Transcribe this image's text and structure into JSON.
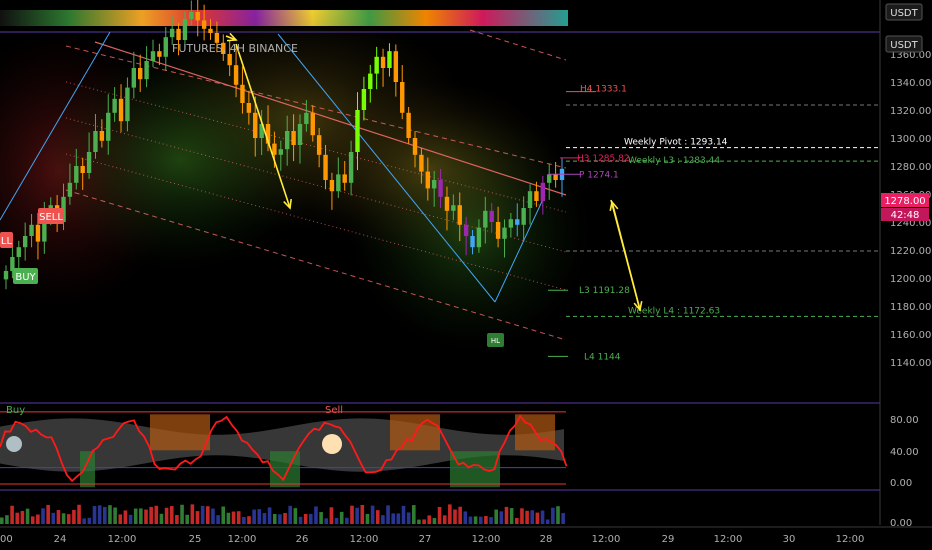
{
  "currency": "USDT",
  "watermark": "FUTURES, 4H BINANCE",
  "price_axis": {
    "ticks": [
      1360,
      1340,
      1320,
      1300,
      1280,
      1260,
      1240,
      1220,
      1200,
      1180,
      1160,
      1140
    ],
    "tick_labels": [
      "1360.00",
      "1340.00",
      "1320.00",
      "1300.00",
      "1280.00",
      "1260.00",
      "1240.00",
      "1220.00",
      "1200.00",
      "1180.00",
      "1160.00",
      "1140.00"
    ],
    "current_price_label": "1278.00",
    "countdown_label": "42:48"
  },
  "osc_axis": {
    "tick_labels": [
      "80.00",
      "40.00",
      "0.00"
    ]
  },
  "vol_axis": {
    "tick_labels": [
      "0.00"
    ]
  },
  "time_axis": {
    "labels": [
      "00",
      "24",
      "12:00",
      "25",
      "12:00",
      "26",
      "12:00",
      "27",
      "12:00",
      "28",
      "12:00",
      "29",
      "12:00",
      "30",
      "12:00"
    ]
  },
  "levels": [
    {
      "label": "H4 1333.1",
      "price": 1333.1,
      "color": "#ef5350",
      "style": "solid"
    },
    {
      "label": "Weekly Pivot : 1293.14",
      "price": 1293.14,
      "color": "#ffffff",
      "style": "dashed"
    },
    {
      "label": "H3 1285.82",
      "price": 1285.82,
      "color": "#e91e63",
      "style": "solid"
    },
    {
      "label": "Weekly L3 : 1283.44",
      "price": 1283.44,
      "color": "#4caf50",
      "style": "dashed"
    },
    {
      "label": "P 1274.1",
      "price": 1274.1,
      "color": "#ab47bc",
      "style": "solid"
    },
    {
      "label": "L3 1191.28",
      "price": 1191.28,
      "color": "#4caf50",
      "style": "solid"
    },
    {
      "label": "Weekly L4 : 1172.63",
      "price": 1172.63,
      "color": "#4caf50",
      "style": "dashed"
    },
    {
      "label": "L4 1144",
      "price": 1144,
      "color": "#4caf50",
      "style": "solid"
    }
  ],
  "signals": {
    "sell_label": "SELL",
    "sell_label_partial": "LL",
    "buy_label": "BUY",
    "hl_label": "HL"
  },
  "oscillator_labels": {
    "buy": "Buy",
    "sell": "Sell"
  },
  "colors": {
    "bull": "#4caf50",
    "bear": "#ff9800",
    "purple": "#9c27b0",
    "blue": "#42a5f5",
    "accent_line": "#f26b6b",
    "osc_line": "#ff1a1a",
    "grid": "#2a2a2a",
    "pane_border": "#5b3aa8"
  },
  "chart_data": {
    "type": "candlestick",
    "symbol_info": "FUTURES, 4H BINANCE",
    "y_range": [
      1130,
      1390
    ],
    "closes": [
      1205,
      1215,
      1222,
      1230,
      1238,
      1226,
      1244,
      1252,
      1240,
      1258,
      1268,
      1280,
      1275,
      1290,
      1305,
      1298,
      1318,
      1328,
      1312,
      1336,
      1350,
      1342,
      1355,
      1362,
      1358,
      1372,
      1378,
      1370,
      1385,
      1390,
      1384,
      1378,
      1375,
      1368,
      1360,
      1352,
      1338,
      1325,
      1318,
      1300,
      1310,
      1296,
      1288,
      1292,
      1305,
      1295,
      1310,
      1318,
      1302,
      1288,
      1270,
      1262,
      1274,
      1268,
      1290,
      1320,
      1335,
      1346,
      1358,
      1350,
      1362,
      1340,
      1318,
      1300,
      1288,
      1276,
      1264,
      1270,
      1258,
      1248,
      1252,
      1238,
      1230,
      1222,
      1236,
      1248,
      1240,
      1228,
      1236,
      1242,
      1238,
      1250,
      1262,
      1255,
      1268,
      1274,
      1270,
      1278
    ]
  }
}
